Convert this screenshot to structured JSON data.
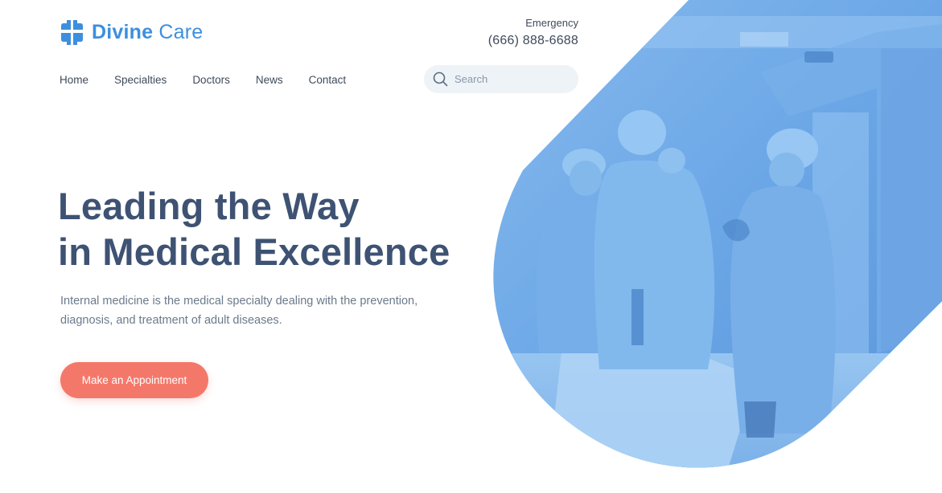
{
  "brand": {
    "name_bold": "Divine",
    "name_regular": "Care",
    "color": "#3d8fde",
    "icon": "cross-logo-icon"
  },
  "emergency": {
    "label": "Emergency",
    "phone": "(666) 888-6688"
  },
  "nav": {
    "items": [
      {
        "label": "Home"
      },
      {
        "label": "Specialties"
      },
      {
        "label": "Doctors"
      },
      {
        "label": "News"
      },
      {
        "label": "Contact"
      }
    ]
  },
  "search": {
    "placeholder": "Search",
    "icon": "search-icon"
  },
  "hero": {
    "title_line1": "Leading the Way",
    "title_line2": "in Medical Excellence",
    "description": "Internal medicine is the medical specialty dealing with the prevention, diagnosis, and treatment of adult diseases.",
    "cta_label": "Make an Appointment",
    "cta_color": "#f4786a",
    "image": "surgeons-in-operating-room-photo",
    "image_tint": "#5aa0e6"
  }
}
